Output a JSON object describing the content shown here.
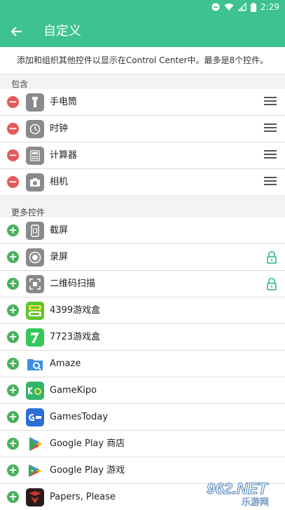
{
  "status": {
    "time": "2:29"
  },
  "header": {
    "title": "自定义"
  },
  "description": "添加和组织其他控件以显示在Control Center中。最多是8个控件。",
  "included": {
    "label": "包含",
    "items": [
      {
        "label": "手电筒",
        "icon": "flashlight-icon"
      },
      {
        "label": "时钟",
        "icon": "clock-icon"
      },
      {
        "label": "计算器",
        "icon": "calculator-icon"
      },
      {
        "label": "相机",
        "icon": "camera-icon"
      }
    ]
  },
  "more": {
    "label": "更多控件",
    "items": [
      {
        "label": "截屏",
        "icon": "screenshot-icon",
        "locked": false
      },
      {
        "label": "录屏",
        "icon": "screen-record-icon",
        "locked": true
      },
      {
        "label": "二维码扫描",
        "icon": "qr-scan-icon",
        "locked": true
      },
      {
        "label": "4399游戏盒",
        "icon": "4399-app-icon",
        "locked": false
      },
      {
        "label": "7723游戏盒",
        "icon": "7723-app-icon",
        "locked": false
      },
      {
        "label": "Amaze",
        "icon": "amaze-app-icon",
        "locked": false
      },
      {
        "label": "GameKipo",
        "icon": "gamekipo-app-icon",
        "locked": false
      },
      {
        "label": "GamesToday",
        "icon": "gamestoday-app-icon",
        "locked": false
      },
      {
        "label": "Google Play 商店",
        "icon": "google-play-store-icon",
        "locked": false
      },
      {
        "label": "Google Play 游戏",
        "icon": "google-play-games-icon",
        "locked": false
      },
      {
        "label": "Papers, Please",
        "icon": "papers-please-app-icon",
        "locked": false
      }
    ]
  },
  "watermark": {
    "text": "962.NET",
    "subtext": "乐游网"
  }
}
